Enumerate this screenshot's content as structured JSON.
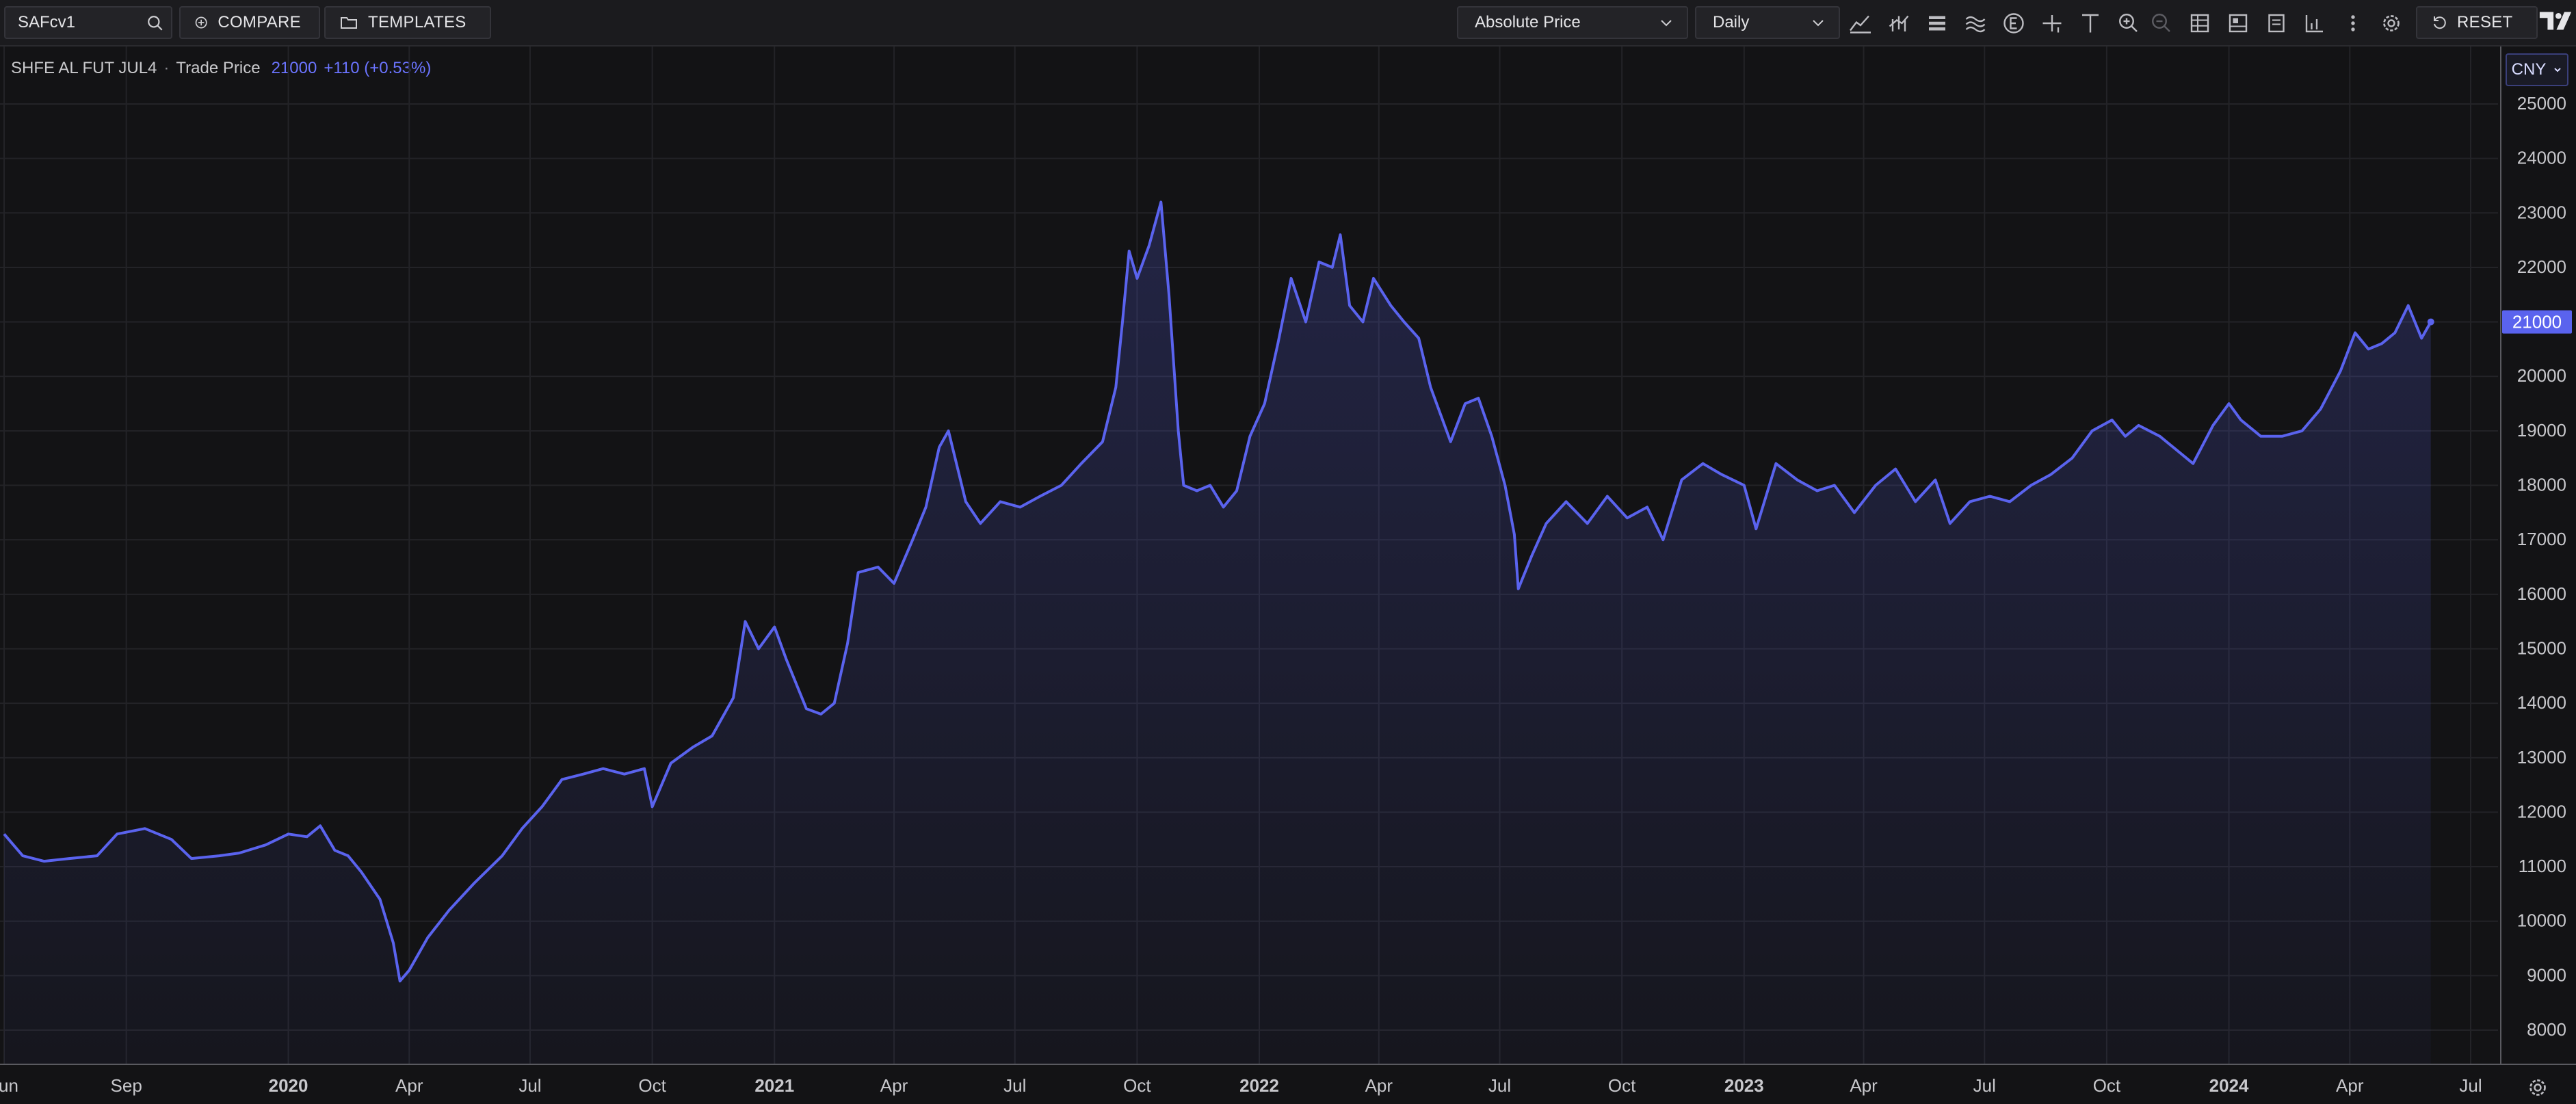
{
  "toolbar": {
    "search_value": "SAFcv1",
    "compare_label": "COMPARE",
    "templates_label": "TEMPLATES",
    "price_mode": "Absolute Price",
    "interval": "Daily",
    "reset_label": "RESET",
    "icons": [
      "mountain-chart-icon",
      "candle-chart-icon",
      "layers-icon",
      "waves-icon",
      "events-icon",
      "crosshair-icon",
      "text-tool-icon",
      "zoom-in-icon",
      "zoom-out-icon",
      "table-icon",
      "layout-icon",
      "report-icon",
      "compare-chart-icon",
      "more-icon",
      "settings-icon"
    ]
  },
  "legend": {
    "instrument": "SHFE AL FUT JUL4",
    "separator": "·",
    "field": "Trade Price",
    "last_value": "21000",
    "change": "+110 (+0.53%)"
  },
  "currency": "CNY",
  "colors": {
    "line": "#5a63ee",
    "accent": "#5a63ee",
    "background": "#131315",
    "grid": "#232327"
  },
  "chart_data": {
    "type": "area",
    "title": "",
    "xlabel": "",
    "ylabel": "",
    "ylim": [
      7500,
      25000
    ],
    "yticks": [
      "25000",
      "24000",
      "23000",
      "22000",
      "21000",
      "20000",
      "19000",
      "18000",
      "17000",
      "16000",
      "15000",
      "14000",
      "13000",
      "12000",
      "11000",
      "10000",
      "9000",
      "8000"
    ],
    "xtick_labels": [
      {
        "date": "2019-06",
        "label": "Jun",
        "bold": false
      },
      {
        "date": "2019-09",
        "label": "Sep",
        "bold": false
      },
      {
        "date": "2020-01",
        "label": "2020",
        "bold": true
      },
      {
        "date": "2020-04",
        "label": "Apr",
        "bold": false
      },
      {
        "date": "2020-07",
        "label": "Jul",
        "bold": false
      },
      {
        "date": "2020-10",
        "label": "Oct",
        "bold": false
      },
      {
        "date": "2021-01",
        "label": "2021",
        "bold": true
      },
      {
        "date": "2021-04",
        "label": "Apr",
        "bold": false
      },
      {
        "date": "2021-07",
        "label": "Jul",
        "bold": false
      },
      {
        "date": "2021-10",
        "label": "Oct",
        "bold": false
      },
      {
        "date": "2022-01",
        "label": "2022",
        "bold": true
      },
      {
        "date": "2022-04",
        "label": "Apr",
        "bold": false
      },
      {
        "date": "2022-07",
        "label": "Jul",
        "bold": false
      },
      {
        "date": "2022-10",
        "label": "Oct",
        "bold": false
      },
      {
        "date": "2023-01",
        "label": "2023",
        "bold": true
      },
      {
        "date": "2023-04",
        "label": "Apr",
        "bold": false
      },
      {
        "date": "2023-07",
        "label": "Jul",
        "bold": false
      },
      {
        "date": "2023-10",
        "label": "Oct",
        "bold": false
      },
      {
        "date": "2024-01",
        "label": "2024",
        "bold": true
      },
      {
        "date": "2024-04",
        "label": "Apr",
        "bold": false
      },
      {
        "date": "2024-07",
        "label": "Jul",
        "bold": false
      }
    ],
    "xlim": [
      "2019-06-01",
      "2024-07-31"
    ],
    "last_value_label": "21000",
    "grid": true,
    "series": [
      {
        "points": [
          [
            "2019-06-01",
            11600
          ],
          [
            "2019-06-15",
            11200
          ],
          [
            "2019-07-01",
            11100
          ],
          [
            "2019-07-20",
            11150
          ],
          [
            "2019-08-10",
            11200
          ],
          [
            "2019-08-25",
            11600
          ],
          [
            "2019-09-15",
            11700
          ],
          [
            "2019-10-05",
            11500
          ],
          [
            "2019-10-20",
            11150
          ],
          [
            "2019-11-10",
            11200
          ],
          [
            "2019-11-25",
            11250
          ],
          [
            "2019-12-15",
            11400
          ],
          [
            "2020-01-01",
            11600
          ],
          [
            "2020-01-15",
            11550
          ],
          [
            "2020-01-25",
            11750
          ],
          [
            "2020-02-05",
            11300
          ],
          [
            "2020-02-15",
            11200
          ],
          [
            "2020-02-25",
            10900
          ],
          [
            "2020-03-10",
            10400
          ],
          [
            "2020-03-20",
            9600
          ],
          [
            "2020-03-25",
            8900
          ],
          [
            "2020-04-01",
            9100
          ],
          [
            "2020-04-15",
            9700
          ],
          [
            "2020-05-01",
            10200
          ],
          [
            "2020-05-20",
            10700
          ],
          [
            "2020-06-10",
            11200
          ],
          [
            "2020-06-25",
            11700
          ],
          [
            "2020-07-10",
            12100
          ],
          [
            "2020-07-25",
            12600
          ],
          [
            "2020-08-10",
            12700
          ],
          [
            "2020-08-25",
            12800
          ],
          [
            "2020-09-10",
            12700
          ],
          [
            "2020-09-25",
            12800
          ],
          [
            "2020-10-01",
            12100
          ],
          [
            "2020-10-15",
            12900
          ],
          [
            "2020-11-01",
            13200
          ],
          [
            "2020-11-15",
            13400
          ],
          [
            "2020-12-01",
            14100
          ],
          [
            "2020-12-10",
            15500
          ],
          [
            "2020-12-20",
            15000
          ],
          [
            "2021-01-01",
            15400
          ],
          [
            "2021-01-10",
            14800
          ],
          [
            "2021-01-25",
            13900
          ],
          [
            "2021-02-05",
            13800
          ],
          [
            "2021-02-15",
            14000
          ],
          [
            "2021-02-25",
            15100
          ],
          [
            "2021-03-05",
            16400
          ],
          [
            "2021-03-20",
            16500
          ],
          [
            "2021-04-01",
            16200
          ],
          [
            "2021-04-15",
            17000
          ],
          [
            "2021-04-25",
            17600
          ],
          [
            "2021-05-05",
            18700
          ],
          [
            "2021-05-12",
            19000
          ],
          [
            "2021-05-25",
            17700
          ],
          [
            "2021-06-05",
            17300
          ],
          [
            "2021-06-20",
            17700
          ],
          [
            "2021-07-05",
            17600
          ],
          [
            "2021-07-20",
            17800
          ],
          [
            "2021-08-05",
            18000
          ],
          [
            "2021-08-20",
            18400
          ],
          [
            "2021-09-05",
            18800
          ],
          [
            "2021-09-15",
            19800
          ],
          [
            "2021-09-20",
            21000
          ],
          [
            "2021-09-25",
            22300
          ],
          [
            "2021-10-01",
            21800
          ],
          [
            "2021-10-10",
            22400
          ],
          [
            "2021-10-19",
            23200
          ],
          [
            "2021-10-25",
            21500
          ],
          [
            "2021-11-01",
            19000
          ],
          [
            "2021-11-05",
            18000
          ],
          [
            "2021-11-15",
            17900
          ],
          [
            "2021-11-25",
            18000
          ],
          [
            "2021-12-05",
            17600
          ],
          [
            "2021-12-15",
            17900
          ],
          [
            "2021-12-25",
            18900
          ],
          [
            "2022-01-05",
            19500
          ],
          [
            "2022-01-15",
            20600
          ],
          [
            "2022-01-25",
            21800
          ],
          [
            "2022-02-05",
            21000
          ],
          [
            "2022-02-15",
            22100
          ],
          [
            "2022-02-25",
            22000
          ],
          [
            "2022-03-03",
            22600
          ],
          [
            "2022-03-10",
            21300
          ],
          [
            "2022-03-20",
            21000
          ],
          [
            "2022-03-28",
            21800
          ],
          [
            "2022-04-10",
            21300
          ],
          [
            "2022-04-20",
            21000
          ],
          [
            "2022-05-01",
            20700
          ],
          [
            "2022-05-10",
            19800
          ],
          [
            "2022-05-25",
            18800
          ],
          [
            "2022-06-05",
            19500
          ],
          [
            "2022-06-15",
            19600
          ],
          [
            "2022-06-25",
            18900
          ],
          [
            "2022-07-05",
            18000
          ],
          [
            "2022-07-12",
            17100
          ],
          [
            "2022-07-15",
            16100
          ],
          [
            "2022-07-25",
            16700
          ],
          [
            "2022-08-05",
            17300
          ],
          [
            "2022-08-20",
            17700
          ],
          [
            "2022-09-05",
            17300
          ],
          [
            "2022-09-20",
            17800
          ],
          [
            "2022-10-05",
            17400
          ],
          [
            "2022-10-20",
            17600
          ],
          [
            "2022-11-01",
            17000
          ],
          [
            "2022-11-15",
            18100
          ],
          [
            "2022-12-01",
            18400
          ],
          [
            "2022-12-15",
            18200
          ],
          [
            "2023-01-01",
            18000
          ],
          [
            "2023-01-10",
            17200
          ],
          [
            "2023-01-25",
            18400
          ],
          [
            "2023-02-10",
            18100
          ],
          [
            "2023-02-25",
            17900
          ],
          [
            "2023-03-10",
            18000
          ],
          [
            "2023-03-25",
            17500
          ],
          [
            "2023-04-10",
            18000
          ],
          [
            "2023-04-25",
            18300
          ],
          [
            "2023-05-10",
            17700
          ],
          [
            "2023-05-25",
            18100
          ],
          [
            "2023-06-05",
            17300
          ],
          [
            "2023-06-20",
            17700
          ],
          [
            "2023-07-05",
            17800
          ],
          [
            "2023-07-20",
            17700
          ],
          [
            "2023-08-05",
            18000
          ],
          [
            "2023-08-20",
            18200
          ],
          [
            "2023-09-05",
            18500
          ],
          [
            "2023-09-20",
            19000
          ],
          [
            "2023-10-05",
            19200
          ],
          [
            "2023-10-15",
            18900
          ],
          [
            "2023-10-25",
            19100
          ],
          [
            "2023-11-10",
            18900
          ],
          [
            "2023-11-25",
            18600
          ],
          [
            "2023-12-05",
            18400
          ],
          [
            "2023-12-20",
            19100
          ],
          [
            "2024-01-01",
            19500
          ],
          [
            "2024-01-10",
            19200
          ],
          [
            "2024-01-25",
            18900
          ],
          [
            "2024-02-10",
            18900
          ],
          [
            "2024-02-25",
            19000
          ],
          [
            "2024-03-10",
            19400
          ],
          [
            "2024-03-25",
            20100
          ],
          [
            "2024-04-05",
            20800
          ],
          [
            "2024-04-15",
            20500
          ],
          [
            "2024-04-25",
            20600
          ],
          [
            "2024-05-05",
            20800
          ],
          [
            "2024-05-15",
            21300
          ],
          [
            "2024-05-25",
            20700
          ],
          [
            "2024-06-01",
            21000
          ]
        ]
      }
    ]
  }
}
